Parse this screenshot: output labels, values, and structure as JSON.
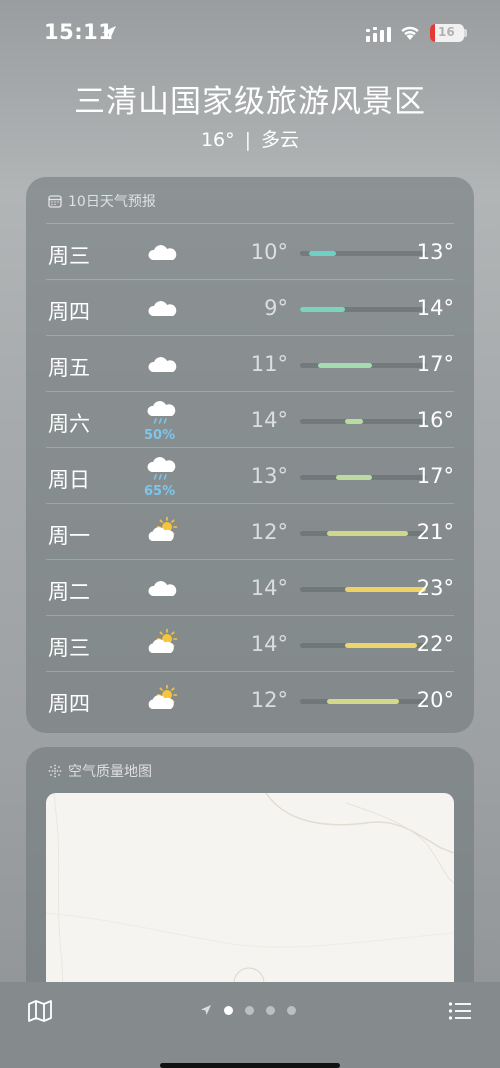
{
  "status_bar": {
    "time": "15:11",
    "battery": "16"
  },
  "location": {
    "name": "三清山国家级旅游风景区",
    "temperature": "16°",
    "separator": "|",
    "condition": "多云"
  },
  "forecast": {
    "title": "10日天气预报",
    "range_min": 9,
    "range_max": 23,
    "days": [
      {
        "day": "周三",
        "icon": "cloud-icon",
        "precip": "",
        "low": "10°",
        "high": "13°",
        "low_value": 10,
        "high_value": 13,
        "color": "#6cd0c2"
      },
      {
        "day": "周四",
        "icon": "cloud-icon",
        "precip": "",
        "low": "9°",
        "high": "14°",
        "low_value": 9,
        "high_value": 14,
        "color": "#7ed3bd"
      },
      {
        "day": "周五",
        "icon": "cloud-icon",
        "precip": "",
        "low": "11°",
        "high": "17°",
        "low_value": 11,
        "high_value": 17,
        "color": "#a4dbb0"
      },
      {
        "day": "周六",
        "icon": "cloud-rain-icon",
        "precip": "50%",
        "low": "14°",
        "high": "16°",
        "low_value": 14,
        "high_value": 16,
        "color": "#b8dca0"
      },
      {
        "day": "周日",
        "icon": "cloud-rain-icon",
        "precip": "65%",
        "low": "13°",
        "high": "17°",
        "low_value": 13,
        "high_value": 17,
        "color": "#bcdba0"
      },
      {
        "day": "周一",
        "icon": "partly-sunny-icon",
        "precip": "",
        "low": "12°",
        "high": "21°",
        "low_value": 12,
        "high_value": 21,
        "color": "#cfd88a"
      },
      {
        "day": "周二",
        "icon": "cloud-icon",
        "precip": "",
        "low": "14°",
        "high": "23°",
        "low_value": 14,
        "high_value": 23,
        "color": "#f0d264"
      },
      {
        "day": "周三",
        "icon": "partly-sunny-icon",
        "precip": "",
        "low": "14°",
        "high": "22°",
        "low_value": 14,
        "high_value": 22,
        "color": "#ecd56e"
      },
      {
        "day": "周四",
        "icon": "partly-sunny-icon",
        "precip": "",
        "low": "12°",
        "high": "20°",
        "low_value": 12,
        "high_value": 20,
        "color": "#d3d98a"
      }
    ]
  },
  "air_quality": {
    "title": "空气质量地图"
  },
  "bottom_bar": {
    "page_count": 4,
    "active_page": 1
  }
}
